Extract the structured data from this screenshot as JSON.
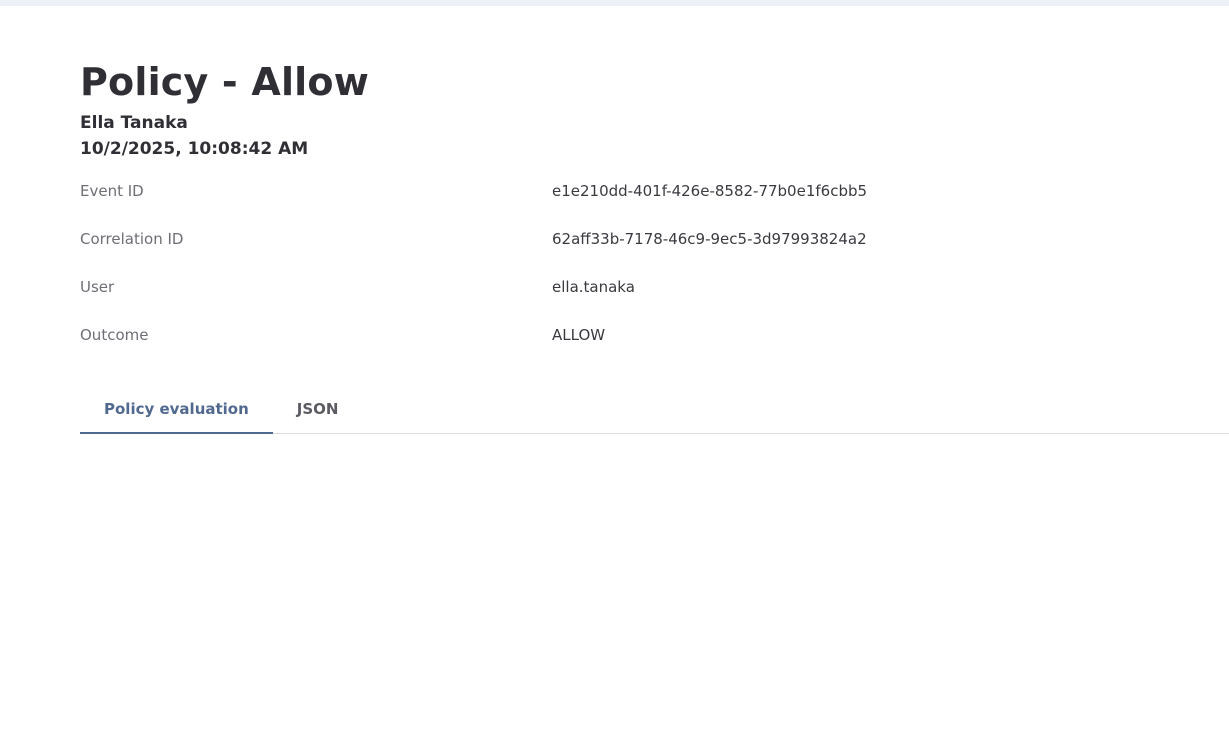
{
  "header": {
    "title": "Policy - Allow",
    "user_name": "Ella Tanaka",
    "timestamp": "10/2/2025, 10:08:42 AM"
  },
  "details": [
    {
      "label": "Event ID",
      "value": "e1e210dd-401f-426e-8582-77b0e1f6cbb5"
    },
    {
      "label": "Correlation ID",
      "value": "62aff33b-7178-46c9-9ec5-3d97993824a2"
    },
    {
      "label": "User",
      "value": "ella.tanaka"
    },
    {
      "label": "Outcome",
      "value": "ALLOW"
    }
  ],
  "tabs": [
    {
      "label": "Policy evaluation",
      "active": true
    },
    {
      "label": "JSON",
      "active": false
    }
  ],
  "colors": {
    "accent": "#51688f",
    "title": "#2f2f35",
    "label": "#6e6e76"
  }
}
